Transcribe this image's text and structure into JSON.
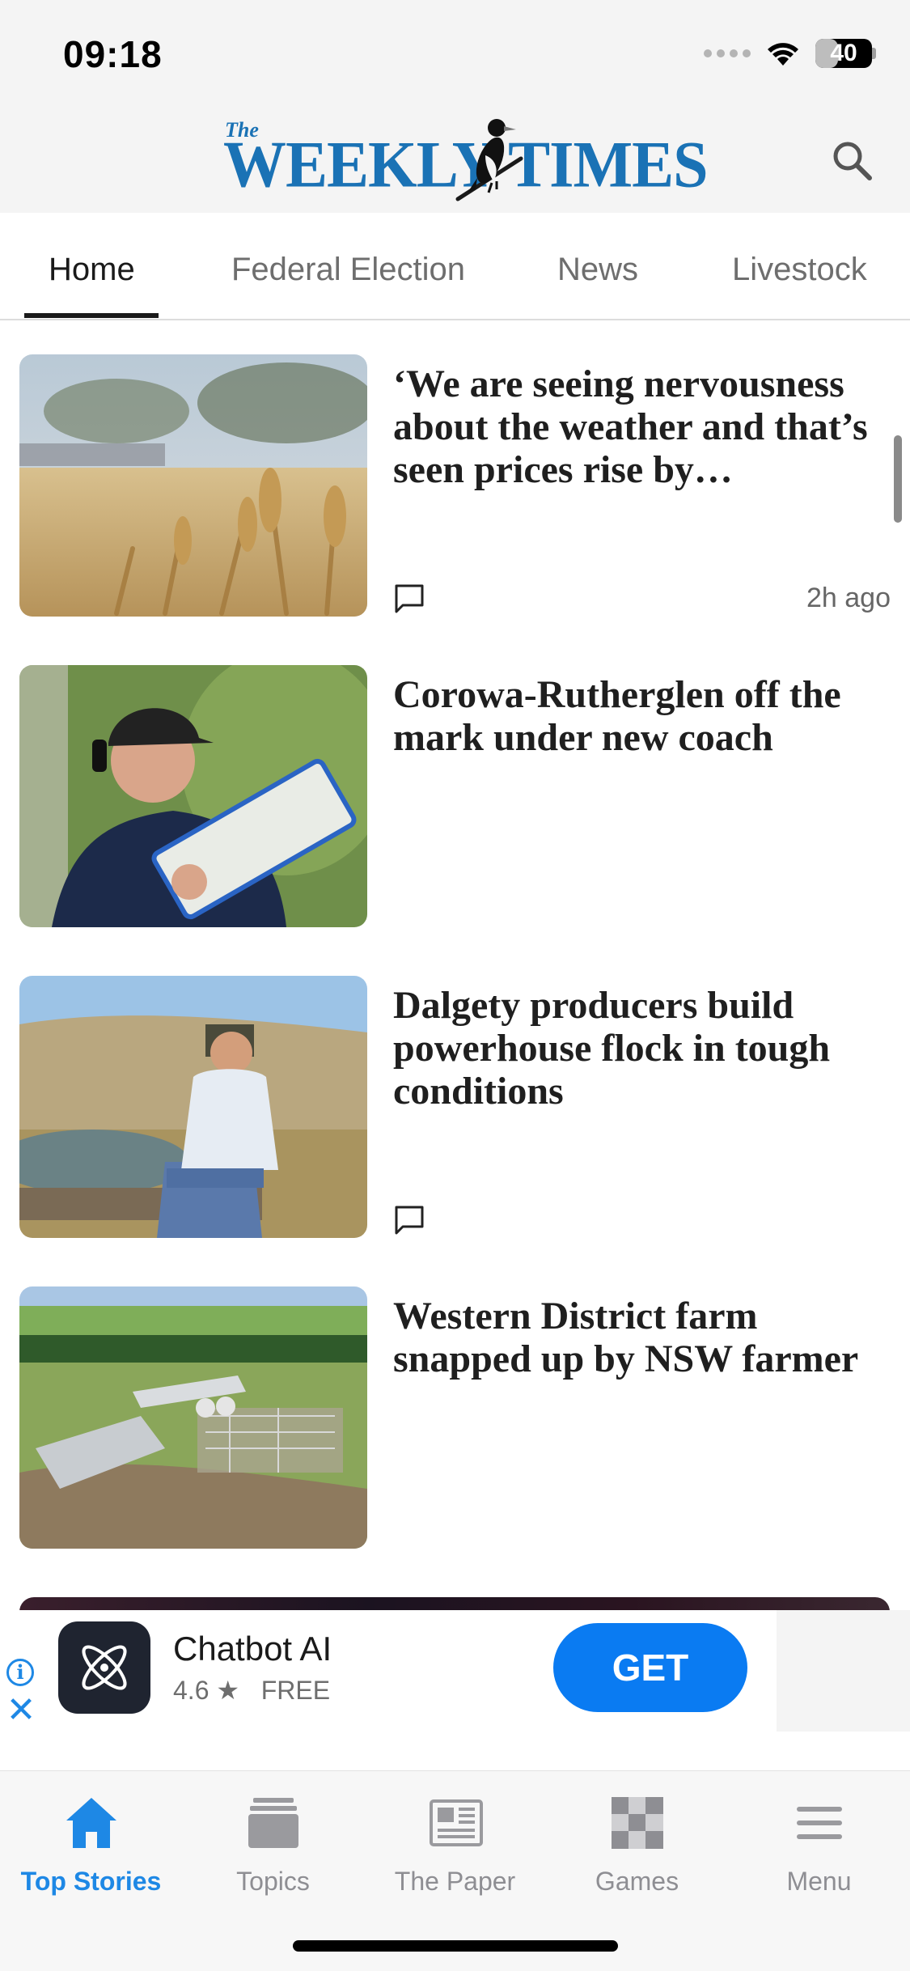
{
  "status_bar": {
    "time": "09:18",
    "battery": "40",
    "battery_level": 0.4
  },
  "header": {
    "logo_small": "The",
    "logo_main": "WEEKLY TIMES",
    "search_icon": "search-icon"
  },
  "tabs": [
    {
      "label": "Home",
      "active": true
    },
    {
      "label": "Federal Election",
      "active": false
    },
    {
      "label": "News",
      "active": false
    },
    {
      "label": "Livestock",
      "active": false
    }
  ],
  "articles": [
    {
      "headline": "‘We are seeing nervousness about the weather and that’s seen prices rise by…",
      "timestamp": "2h ago",
      "has_comments": true,
      "image": "wheat-field"
    },
    {
      "headline": "Corowa-Rutherglen off the mark under new coach",
      "timestamp": "",
      "has_comments": false,
      "image": "coach-with-clipboard"
    },
    {
      "headline": "Dalgety producers build powerhouse flock in tough conditions",
      "timestamp": "",
      "has_comments": true,
      "image": "farmer-by-dam"
    },
    {
      "headline": "Western District farm snapped up by NSW farmer",
      "timestamp": "",
      "has_comments": false,
      "image": "aerial-farm-sheds"
    }
  ],
  "ad": {
    "title": "Chatbot AI",
    "rating": "4.6",
    "star": "★",
    "price": "FREE",
    "cta": "GET",
    "info_icon": "i",
    "close_icon": "✕"
  },
  "bottom_nav": [
    {
      "label": "Top Stories",
      "icon": "home-icon",
      "active": true
    },
    {
      "label": "Topics",
      "icon": "topics-icon",
      "active": false
    },
    {
      "label": "The Paper",
      "icon": "newspaper-icon",
      "active": false
    },
    {
      "label": "Games",
      "icon": "games-icon",
      "active": false
    },
    {
      "label": "Menu",
      "icon": "menu-icon",
      "active": false
    }
  ],
  "colors": {
    "brand_blue": "#1a72b5",
    "accent_blue": "#1e88e5",
    "get_button": "#0a7bf2"
  }
}
